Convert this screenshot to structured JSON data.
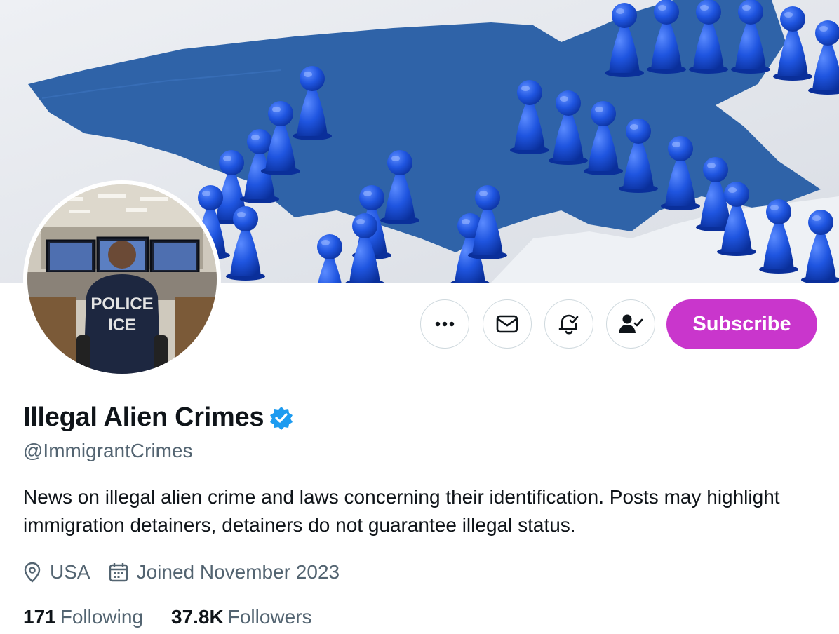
{
  "profile": {
    "name": "Illegal Alien Crimes",
    "handle": "@ImmigrantCrimes",
    "bio": "News on illegal alien crime and laws concerning their identification. Posts may highlight immigration detainers, detainers do not guarantee illegal status.",
    "location": "USA",
    "joined": "Joined November 2023",
    "following_count": "171",
    "following_label": "Following",
    "followers_count": "37.8K",
    "followers_label": "Followers",
    "verified": true
  },
  "avatar": {
    "vest_line1": "POLICE",
    "vest_line2": "ICE"
  },
  "actions": {
    "more_icon": "more-icon",
    "message_icon": "mail-icon",
    "notify_icon": "bell-icon",
    "following_icon": "person-check-icon",
    "subscribe_label": "Subscribe"
  },
  "colors": {
    "subscribe_bg": "#c936cc",
    "verified_badge": "#1d9bf0",
    "secondary_text": "#536471",
    "banner_map": "#2f63a8",
    "banner_pawns": "#1f55e0"
  }
}
